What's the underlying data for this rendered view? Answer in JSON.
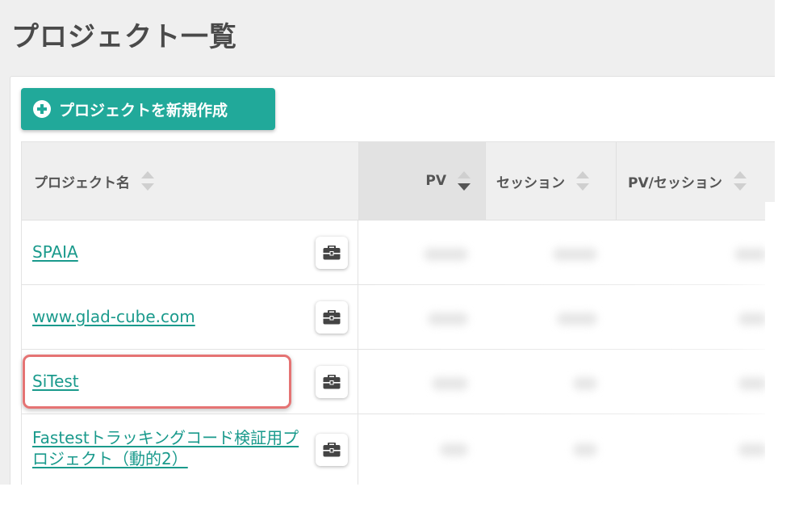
{
  "page": {
    "title": "プロジェクト一覧"
  },
  "toolbar": {
    "create_label": "プロジェクトを新規作成"
  },
  "table": {
    "columns": [
      {
        "label": "プロジェクト名",
        "sort": "none"
      },
      {
        "label": "PV",
        "sort": "desc"
      },
      {
        "label": "セッション",
        "sort": "none"
      },
      {
        "label": "PV/セッション",
        "sort": "none"
      }
    ],
    "rows": [
      {
        "name": "SPAIA"
      },
      {
        "name": "www.glad-cube.com"
      },
      {
        "name": "SiTest",
        "highlighted": true
      },
      {
        "name": "Fastestトラッキングコード検証用プロジェクト（動的2）"
      }
    ]
  },
  "colors": {
    "accent": "#21a99a",
    "link": "#1a9a8c",
    "highlight": "#e57373"
  },
  "icons": {
    "create": "plus-circle-icon",
    "row_action": "briefcase-icon",
    "sort": "sort-arrows-icon"
  }
}
